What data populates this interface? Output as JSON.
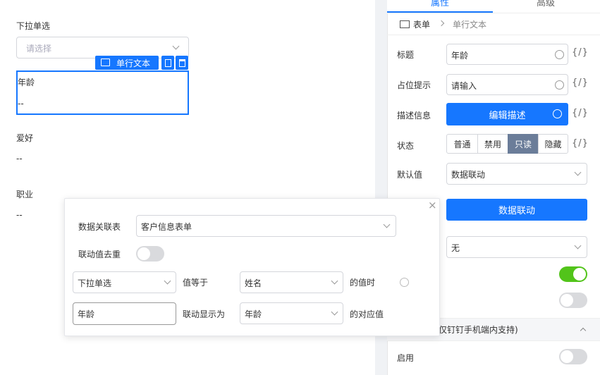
{
  "canvas": {
    "field_dropdown_label": "下拉单选",
    "field_dropdown_placeholder": "请选择",
    "selected_tag": "单行文本",
    "field_age_label": "年龄",
    "field_age_value": "--",
    "field_hobby_label": "爱好",
    "field_hobby_value": "--",
    "field_job_label": "职业",
    "field_job_value": "--"
  },
  "panel": {
    "tab_props": "属性",
    "tab_advanced": "高级",
    "breadcrumb_form": "表单",
    "breadcrumb_field": "单行文本",
    "title_label": "标题",
    "title_value": "年龄",
    "placeholder_label": "占位提示",
    "placeholder_value": "请输入",
    "desc_label": "描述信息",
    "desc_button": "编辑描述",
    "state_label": "状态",
    "state_options": [
      "普通",
      "禁用",
      "只读",
      "隐藏"
    ],
    "default_label": "默认值",
    "default_value": "数据联动",
    "linkage_button": "数据联动",
    "none_value": "无",
    "dingtalk_section": "仅钉钉手机端内支持)",
    "enable_label": "启用",
    "curly": "{/}"
  },
  "popup": {
    "table_label": "数据关联表",
    "table_value": "客户信息表单",
    "dedupe_label": "联动值去重",
    "cond_field": "下拉单选",
    "cond_op": "值等于",
    "cond_target": "姓名",
    "cond_suffix": "的值时",
    "display_field": "年龄",
    "display_op": "联动显示为",
    "display_target": "年龄",
    "display_suffix": "的对应值",
    "close": "×"
  }
}
